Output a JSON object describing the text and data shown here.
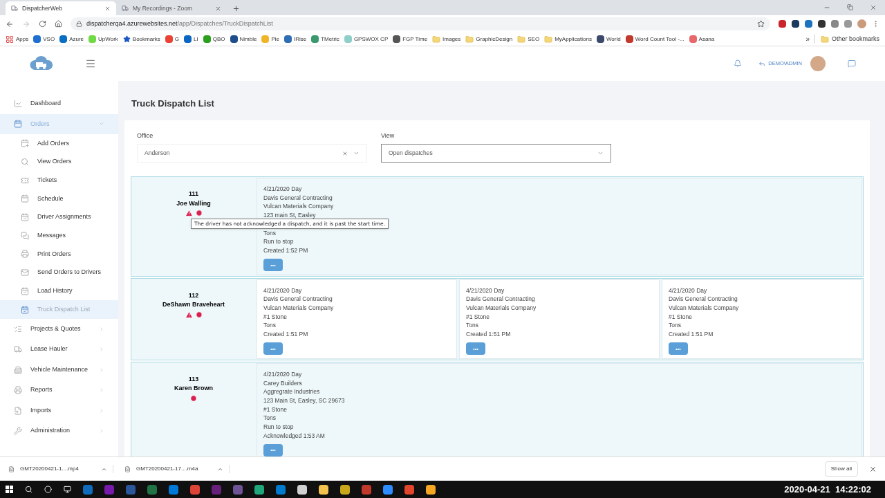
{
  "browser": {
    "tabs": [
      {
        "title": "DispatcherWeb",
        "selected": true
      },
      {
        "title": "My Recordings - Zoom",
        "selected": false
      }
    ],
    "url_host": "dispatcherqa4.azurewebsites.net",
    "url_path": "/app/Dispatches/TruckDispatchList",
    "bookmarks": [
      {
        "label": "Apps",
        "kind": "apps"
      },
      {
        "label": "VSO",
        "kind": "site",
        "color": "#1e6fd0"
      },
      {
        "label": "Azure",
        "kind": "site",
        "color": "#0a6fc2"
      },
      {
        "label": "UpWork",
        "kind": "site",
        "color": "#6fda44"
      },
      {
        "label": "Bookmarks",
        "kind": "star",
        "color": "#1a56c8"
      },
      {
        "label": "G",
        "kind": "site",
        "color": "#ea4335"
      },
      {
        "label": "LI",
        "kind": "site",
        "color": "#0a66c2"
      },
      {
        "label": "QBO",
        "kind": "site",
        "color": "#2ca01c"
      },
      {
        "label": "Nimble",
        "kind": "site",
        "color": "#1f4e8c"
      },
      {
        "label": "Pie",
        "kind": "site",
        "color": "#f0b429"
      },
      {
        "label": "IRise",
        "kind": "site",
        "color": "#2f6db5"
      },
      {
        "label": "TMetric",
        "kind": "site",
        "color": "#3a9a6e"
      },
      {
        "label": "GPSWOX CP",
        "kind": "site",
        "color": "#8ecfc9"
      },
      {
        "label": "FGP Time",
        "kind": "site",
        "color": "#555555"
      },
      {
        "label": "Images",
        "kind": "folder"
      },
      {
        "label": "GraphicDesign",
        "kind": "folder"
      },
      {
        "label": "SEO",
        "kind": "folder"
      },
      {
        "label": "MyApplications",
        "kind": "folder"
      },
      {
        "label": "World",
        "kind": "site",
        "color": "#3b4a6b"
      },
      {
        "label": "Word Count Tool -...",
        "kind": "site",
        "color": "#c0392b"
      },
      {
        "label": "Asana",
        "kind": "site",
        "color": "#e8676b"
      }
    ],
    "more": "»",
    "other_bookmarks": "Other bookmarks"
  },
  "header": {
    "user": "DEMO\\ADMIN"
  },
  "sidebar": [
    {
      "label": "Dashboard",
      "selected": false
    },
    {
      "label": "Orders",
      "expandable": true,
      "expanded": true,
      "selected": true,
      "children": [
        {
          "label": "Add Orders",
          "selected": false
        },
        {
          "label": "View Orders",
          "selected": false
        },
        {
          "label": "Tickets",
          "selected": false
        },
        {
          "label": "Schedule",
          "selected": false
        },
        {
          "label": "Driver Assignments",
          "selected": false
        },
        {
          "label": "Messages",
          "selected": false
        },
        {
          "label": "Print Orders",
          "selected": false
        },
        {
          "label": "Send Orders to Drivers",
          "selected": false
        },
        {
          "label": "Load History",
          "selected": false
        },
        {
          "label": "Truck Dispatch List",
          "selected": true
        }
      ]
    },
    {
      "label": "Projects & Quotes",
      "expandable": true,
      "expanded": false,
      "selected": false
    },
    {
      "label": "Lease Hauler",
      "expandable": true,
      "expanded": false,
      "selected": false
    },
    {
      "label": "Vehicle Maintenance",
      "expandable": true,
      "expanded": false,
      "selected": false
    },
    {
      "label": "Reports",
      "expandable": true,
      "expanded": false,
      "selected": false
    },
    {
      "label": "Imports",
      "expandable": true,
      "expanded": false,
      "selected": false
    },
    {
      "label": "Administration",
      "expandable": true,
      "expanded": false,
      "selected": false
    }
  ],
  "page": {
    "title": "Truck Dispatch List",
    "filters": [
      {
        "label": "Office",
        "value": "Anderson",
        "clearable": true,
        "highlighted": false
      },
      {
        "label": "View",
        "value": "Open dispatches",
        "clearable": false,
        "highlighted": true
      }
    ],
    "trucks": [
      {
        "number": "111",
        "driver": "Joe Walling",
        "warning": true,
        "late": true,
        "tooltip": "The driver has not acknowledged a dispatch, and it is past the start time.",
        "dispatches": [
          {
            "lines": [
              "4/21/2020 Day",
              "Davis General Contracting",
              "Vulcan Materials Company",
              "123 main St, Easley",
              "Tons",
              "Run to stop",
              "Created 1:52 PM"
            ],
            "button": "•••"
          }
        ]
      },
      {
        "number": "112",
        "driver": "DeShawn Braveheart",
        "warning": true,
        "late": true,
        "dispatches": [
          {
            "lines": [
              "4/21/2020 Day",
              "Davis General Contracting",
              "Vulcan Materials Company",
              "#1 Stone",
              "Tons",
              "Created 1:51 PM"
            ],
            "button": "•••"
          },
          {
            "lines": [
              "4/21/2020 Day",
              "Davis General Contracting",
              "Vulcan Materials Company",
              "#1 Stone",
              "Tons",
              "Created 1:51 PM"
            ],
            "button": "•••"
          },
          {
            "lines": [
              "4/21/2020 Day",
              "Davis General Contracting",
              "Vulcan Materials Company",
              "#1 Stone",
              "Tons",
              "Created 1:51 PM"
            ],
            "button": "•••"
          }
        ]
      },
      {
        "number": "113",
        "driver": "Karen Brown",
        "warning": false,
        "late": true,
        "dispatches": [
          {
            "lines": [
              "4/21/2020 Day",
              "Carey Builders",
              "Aggregrate Industries",
              "123 Main St, Easley, SC 29673",
              "#1 Stone",
              "Tons",
              "Run to stop",
              "Acknowledged 1:53 AM"
            ],
            "button": "•••"
          }
        ]
      }
    ]
  },
  "downloads": {
    "items": [
      {
        "name": "GMT20200421-1....mp4"
      },
      {
        "name": "GMT20200421-17....m4a"
      }
    ],
    "show_all": "Show all"
  },
  "taskbar": {
    "apps": [
      {
        "color": "#0f6cbd"
      },
      {
        "color": "#7719aa"
      },
      {
        "color": "#2b579a"
      },
      {
        "color": "#217346"
      },
      {
        "color": "#0078d7"
      },
      {
        "color": "#db4437"
      },
      {
        "color": "#68217a"
      },
      {
        "color": "#6e5494"
      },
      {
        "color": "#1fa67a"
      },
      {
        "color": "#007acc"
      },
      {
        "color": "#d0d0d0"
      },
      {
        "color": "#f2c14e"
      },
      {
        "color": "#c8a81a"
      },
      {
        "color": "#c0392b"
      },
      {
        "color": "#2d8cff"
      },
      {
        "color": "#e2452c"
      },
      {
        "color": "#f5a623"
      }
    ],
    "clock": "2020-04-21  14:22:02"
  }
}
